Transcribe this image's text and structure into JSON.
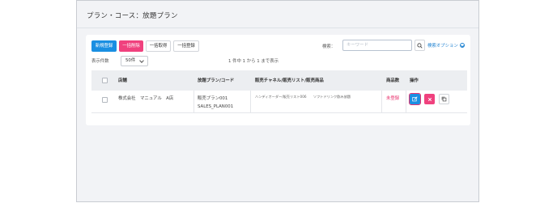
{
  "page": {
    "title": "プラン・コース：放題プラン"
  },
  "toolbar": {
    "new_label": "新規登録",
    "bulk_delete_label": "一括削除",
    "bulk_get_label": "一括取得",
    "bulk_register_label": "一括登録"
  },
  "search": {
    "label": "検索：",
    "placeholder": "キーワード",
    "options_label": "検索オプション"
  },
  "pagination": {
    "per_page_label": "表示件数",
    "per_page_value": "50件",
    "count_text": "1 件中 1 から 1 まで表示"
  },
  "table": {
    "headers": {
      "store": "店舗",
      "plan": "放題プラン/コード",
      "channel": "販売チャネル/販売リスト/販売商品",
      "count": "商品数",
      "actions": "操作"
    },
    "rows": [
      {
        "store": "株式会社　マニュアル　A店",
        "plan_name": "販売プラン001",
        "plan_code": "SALES_PLAN001",
        "channel": "ハンディオーダー/販売リスト006　　ソフトドリンク飲み放題",
        "count": "未登録"
      }
    ]
  },
  "colors": {
    "primary": "#1a8fe2",
    "danger": "#f0417e",
    "unregistered": "#e8336e",
    "link": "#1a7fd0"
  },
  "icons": {
    "search": "search-icon",
    "options": "chevron-circle-icon",
    "edit": "edit-icon",
    "delete": "close-icon",
    "copy": "copy-icon"
  }
}
